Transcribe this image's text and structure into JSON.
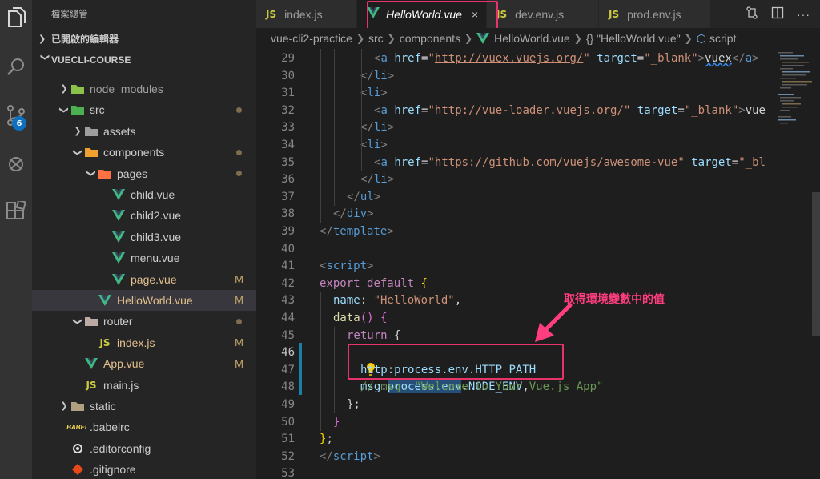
{
  "activity_bar": {
    "icons": [
      "explorer-icon",
      "search-icon",
      "source-control-icon",
      "debug-icon",
      "extensions-icon"
    ],
    "scm_badge": "6"
  },
  "sidebar": {
    "title": "檔案總管",
    "open_editors": "已開啟的編輯器",
    "project": "VUECLI-COURSE",
    "tree": [
      {
        "label": "node_modules",
        "type": "folder",
        "depth": 1,
        "expanded": false,
        "status": ""
      },
      {
        "label": "src",
        "type": "folder",
        "depth": 1,
        "expanded": true,
        "status": "dot"
      },
      {
        "label": "assets",
        "type": "folder",
        "depth": 2,
        "expanded": false,
        "status": ""
      },
      {
        "label": "components",
        "type": "folder",
        "depth": 2,
        "expanded": true,
        "status": "dot"
      },
      {
        "label": "pages",
        "type": "folder",
        "depth": 3,
        "expanded": true,
        "status": "dot"
      },
      {
        "label": "child.vue",
        "type": "vue",
        "depth": 4,
        "status": ""
      },
      {
        "label": "child2.vue",
        "type": "vue",
        "depth": 4,
        "status": ""
      },
      {
        "label": "child3.vue",
        "type": "vue",
        "depth": 4,
        "status": ""
      },
      {
        "label": "menu.vue",
        "type": "vue",
        "depth": 4,
        "status": ""
      },
      {
        "label": "page.vue",
        "type": "vue",
        "depth": 4,
        "status": "M"
      },
      {
        "label": "HelloWorld.vue",
        "type": "vue",
        "depth": 3,
        "status": "M",
        "selected": true
      },
      {
        "label": "router",
        "type": "folder",
        "depth": 2,
        "expanded": true,
        "status": "dot"
      },
      {
        "label": "index.js",
        "type": "js",
        "depth": 3,
        "status": "M"
      },
      {
        "label": "App.vue",
        "type": "vue",
        "depth": 2,
        "status": "M"
      },
      {
        "label": "main.js",
        "type": "js",
        "depth": 2,
        "status": ""
      },
      {
        "label": "static",
        "type": "folder",
        "depth": 1,
        "expanded": false,
        "status": ""
      },
      {
        "label": ".babelrc",
        "type": "babel",
        "depth": 1,
        "status": ""
      },
      {
        "label": ".editorconfig",
        "type": "config",
        "depth": 1,
        "status": ""
      },
      {
        "label": ".gitignore",
        "type": "git",
        "depth": 1,
        "status": ""
      }
    ]
  },
  "tabs": [
    {
      "label": "index.js",
      "kind": "js"
    },
    {
      "label": "HelloWorld.vue",
      "kind": "vue",
      "active": true,
      "close": "×"
    },
    {
      "label": "dev.env.js",
      "kind": "js"
    },
    {
      "label": "prod.env.js",
      "kind": "js"
    }
  ],
  "breadcrumb": {
    "parts": [
      "vue-cli2-practice",
      "src",
      "components",
      "HelloWorld.vue",
      "{} \"HelloWorld.vue\"",
      "script"
    ]
  },
  "editor": {
    "first_line": 29,
    "current_line": 46,
    "lines": [
      "29",
      "30",
      "31",
      "32",
      "33",
      "34",
      "35",
      "36",
      "37",
      "38",
      "39",
      "40",
      "41",
      "42",
      "43",
      "44",
      "45",
      "46",
      "47",
      "48",
      "49",
      "50",
      "51",
      "52",
      "53"
    ],
    "text": {
      "l29_url": "http://vuex.vuejs.org/",
      "l29_text": "vuex",
      "l32_url": "http://vue-loader.vuejs.org/",
      "l32_text": "vue",
      "l35_url": "https://github.com/vuejs/awesome-vue",
      "l35_tail": "_bl",
      "target": "target",
      "blank": "\"_blank\"",
      "href": "href",
      "l43_key": "name",
      "l43_val": "\"HelloWorld\"",
      "l46_key": "msg",
      "l46_obj": "process.env",
      "l46_prop": "NODE_ENV",
      "l47_key": "http",
      "l47_obj": "process.env",
      "l47_prop": "HTTP_PATH",
      "l48_comment": "// msg: \"Welcome to Your Vue.js App\""
    }
  },
  "annotation": {
    "text": "取得環境變數中的值",
    "color": "#ff3d7f"
  },
  "colors": {
    "highlight_box": "#e8336a",
    "accent": "#0e70c0"
  }
}
